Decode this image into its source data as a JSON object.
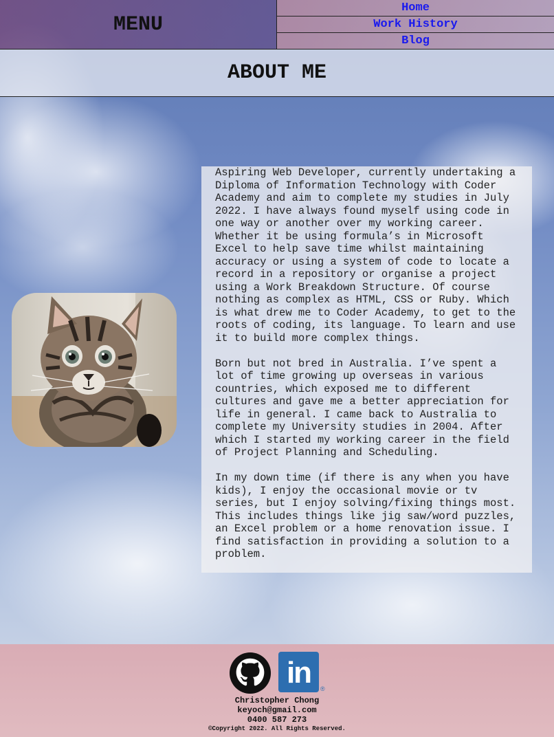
{
  "header": {
    "menu_label": "MENU",
    "nav": [
      {
        "label": "Home"
      },
      {
        "label": "Work History"
      },
      {
        "label": "Blog"
      }
    ]
  },
  "about": {
    "title": "ABOUT ME",
    "photo_alt": "kitten photo",
    "paragraphs": [
      "Aspiring Web Developer, currently undertaking a Diploma of Information Technology with Coder Academy and aim to complete my studies in July 2022. I have always found myself using code in one way or another over my working career. Whether it be using formula’s in Microsoft Excel to help save time whilst maintaining accuracy or using a system of code to locate a record in a repository or organise a project using a Work Breakdown Structure. Of course nothing as complex as HTML, CSS or Ruby. Which is what drew me to Coder Academy, to get to the roots of coding, its language. To learn and use it to build more complex things.",
      "Born but not bred in Australia. I’ve spent a lot of time growing up overseas in various countries, which exposed me to different cultures and gave me a better appreciation for life in general. I came back to Australia to complete my University studies in 2004. After which I started my working career in the field of Project Planning and Scheduling.",
      "In my down time (if there is any when you have kids), I enjoy the occasional movie or tv series, but I enjoy solving/fixing things most. This includes things like jig saw/word puzzles, an Excel problem or a home renovation issue. I find satisfaction in providing a solution to a problem."
    ]
  },
  "footer": {
    "icons": [
      "github-icon",
      "linkedin-icon"
    ],
    "linkedin_text": "in",
    "name": "Christopher Chong",
    "email": "keyoch@gmail.com",
    "phone": "0400 587 273",
    "copyright": "©Copyright 2022. All Rights Reserved."
  },
  "colors": {
    "nav_link": "#1a1aee",
    "linkedin_blue": "#2d6eb0",
    "footer_pink": "#daaab2"
  }
}
